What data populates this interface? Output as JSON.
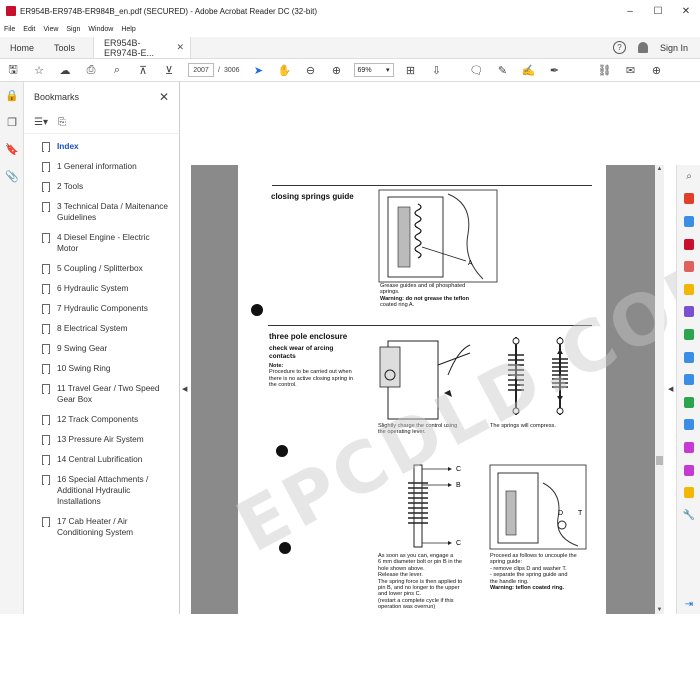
{
  "window": {
    "title": "ER954B-ER974B-ER984B_en.pdf (SECURED) - Adobe Acrobat Reader DC (32-bit)",
    "controls": [
      "–",
      "☐",
      "✕"
    ]
  },
  "menu": [
    "File",
    "Edit",
    "View",
    "Sign",
    "Window",
    "Help"
  ],
  "tabs": {
    "home": "Home",
    "tools": "Tools",
    "document": "ER954B-ER974B-E...",
    "sign_in": "Sign In",
    "help_glyph": "?"
  },
  "toolbar": {
    "current_page": "2007",
    "page_separator": "/",
    "total_pages": "3006",
    "zoom": "69%"
  },
  "bookmarks": {
    "title": "Bookmarks",
    "items": [
      "Index",
      "1 General information",
      "2 Tools",
      "3 Technical Data / Maitenance Guidelines",
      "4 Diesel Engine - Electric Motor",
      "5 Coupling / Splitterbox",
      "6 Hydraulic System",
      "7 Hydraulic Components",
      "8 Electrical System",
      "9 Swing Gear",
      "10 Swing Ring",
      "11 Travel Gear / Two Speed Gear Box",
      "12 Track Components",
      "13 Pressure Air System",
      "14 Central Lubrification",
      "16 Special Attachments / Additional Hydraulic Installations",
      "17 Cab Heater / Air Conditioning System"
    ]
  },
  "document": {
    "section1_title": "closing springs guide",
    "label_A1": "A",
    "caption1_line1": "Grease guides and oil phosphated",
    "caption1_line2": "springs.",
    "caption1_line3": "Warning: do not grease the teflon",
    "caption1_line4": "coated ring A.",
    "section2_title": "three pole enclosure",
    "section2_sub1": "check wear of arcing",
    "section2_sub2": "contacts",
    "note_head": "Note:",
    "note_line1": "Procedure to be carried out when",
    "note_line2": "there is no active closing spring in",
    "note_line3": "the control.",
    "caption2_line1": "Slightly charge the control using",
    "caption2_line2": "the operating lever.",
    "caption3": "The springs will compress.",
    "label_C_top": "C",
    "label_B": "B",
    "label_C_bottom": "C",
    "label_D": "D",
    "label_T": "T",
    "caption4_lines": [
      "As soon as you can, engage a",
      "6 mm diameter bolt or pin B in the",
      "hole shown above.",
      "Release the lever.",
      "The spring force is then applied to",
      "pin B, and no longer to the upper",
      "and lower pins C.",
      "(restart a complete cycle if this",
      "operation was overrun)"
    ],
    "caption5_lines": [
      "Proceed as follows to uncouple the",
      "spring guide:",
      "- remove clips D and washer T.",
      "- separate the spring guide and",
      "the handle ring.",
      "Warning: teflon coated ring."
    ],
    "watermark": "EPCDLD.COM"
  },
  "colors": {
    "accent": "#1a6ed8",
    "viewport_bg": "#8a8a8a",
    "adobe_red": "#c8102e"
  },
  "icons": {
    "right_strip": [
      "#e0402a",
      "#3a8ee6",
      "#c8102e",
      "#e06060",
      "#f2b705",
      "#7a4fd0",
      "#2da44e",
      "#3a8ee6",
      "#3a8ee6",
      "#2da44e",
      "#3a8ee6",
      "#c63ad3",
      "#c63ad3",
      "#f2b705",
      "#666666"
    ]
  }
}
